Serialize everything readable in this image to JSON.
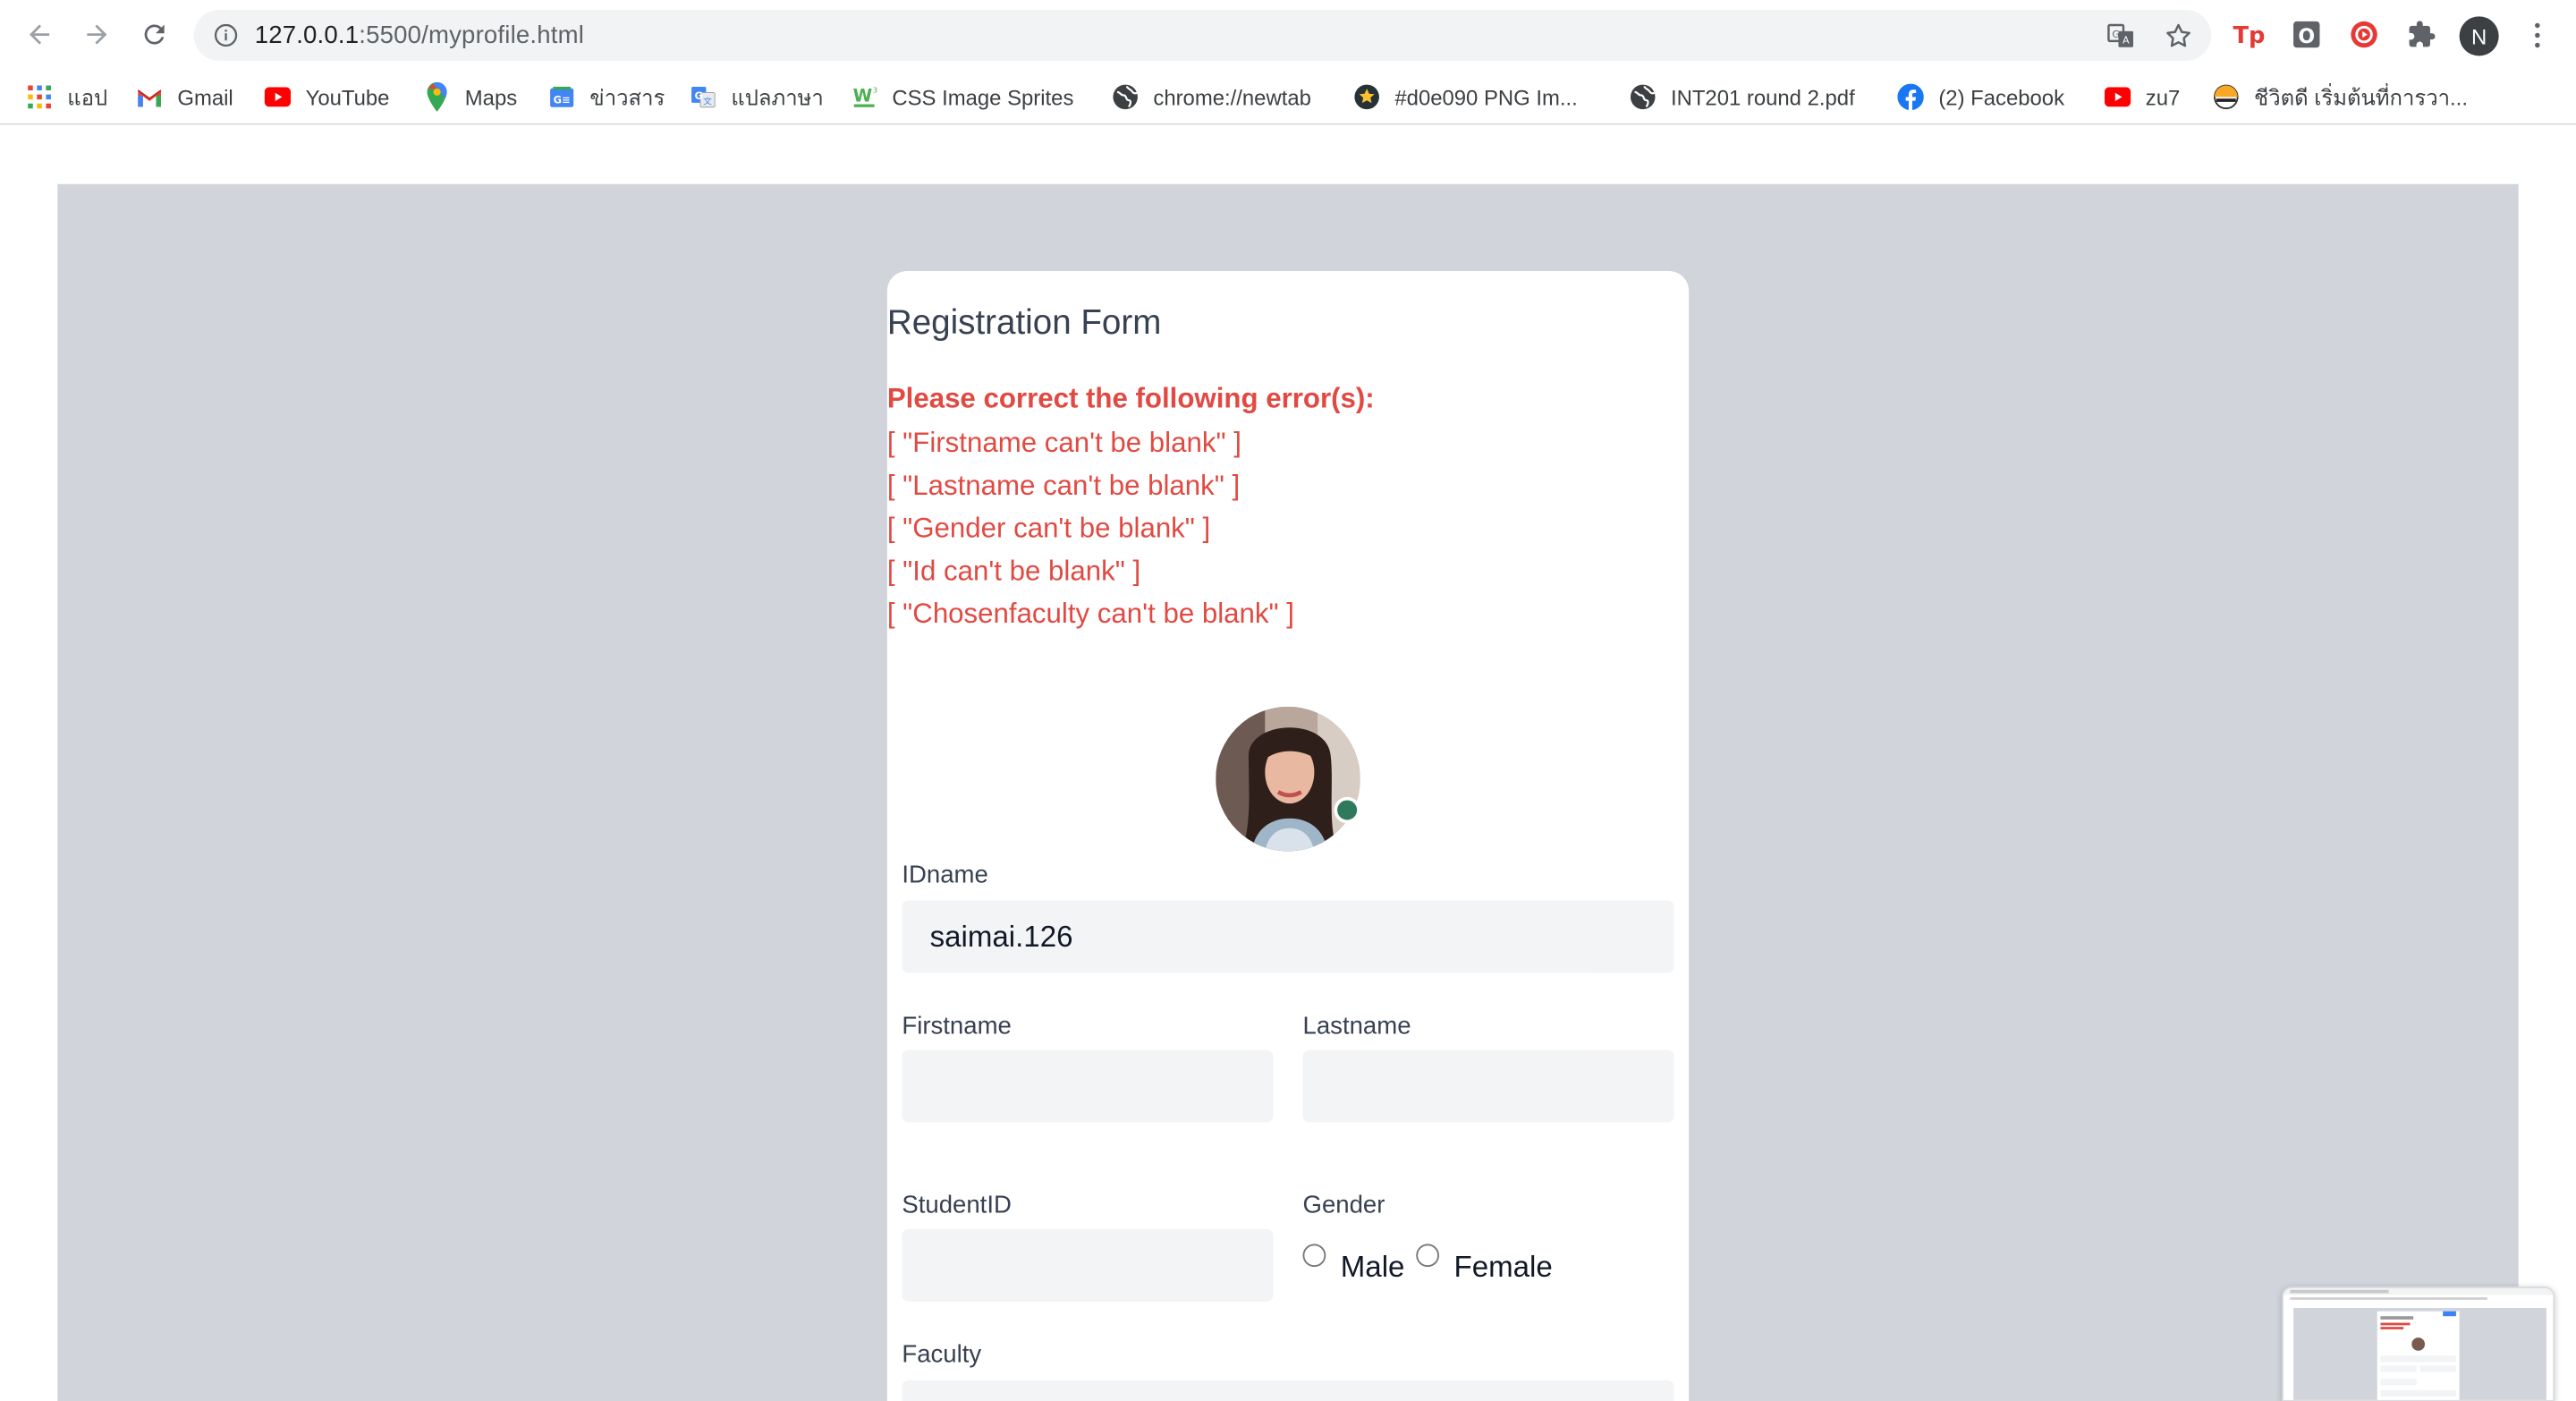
{
  "browser": {
    "url_host": "127.0.0.1",
    "url_path": ":5500/myprofile.html",
    "profile_initial": "N"
  },
  "bookmarks": [
    {
      "label": "แอป",
      "icon": "apps-grid-icon"
    },
    {
      "label": "Gmail",
      "icon": "gmail-icon"
    },
    {
      "label": "YouTube",
      "icon": "youtube-icon"
    },
    {
      "label": "Maps",
      "icon": "maps-pin-icon"
    },
    {
      "label": "ข่าวสาร",
      "icon": "google-news-icon"
    },
    {
      "label": "แปลภาษา",
      "icon": "google-translate-icon"
    },
    {
      "label": "CSS Image Sprites",
      "icon": "w3schools-icon"
    },
    {
      "label": "chrome://newtab",
      "icon": "globe-icon"
    },
    {
      "label": "#d0e090 PNG Im...",
      "icon": "star-badge-icon"
    },
    {
      "label": "INT201 round 2.pdf",
      "icon": "globe-icon"
    },
    {
      "label": "(2) Facebook",
      "icon": "facebook-icon"
    },
    {
      "label": "zu7",
      "icon": "youtube-icon"
    },
    {
      "label": "ชีวิตดี เริ่มต้นที่การวา...",
      "icon": "sun-logo-icon"
    }
  ],
  "form": {
    "title": "Registration Form",
    "error_heading": "Please correct the following error(s):",
    "errors": [
      "[ \"Firstname can't be blank\" ]",
      "[ \"Lastname can't be blank\" ]",
      "[ \"Gender can't be blank\" ]",
      "[ \"Id can't be blank\" ]",
      "[ \"Chosenfaculty can't be blank\" ]"
    ],
    "idname_label": "IDname",
    "idname_value": "saimai.126",
    "firstname_label": "Firstname",
    "firstname_value": "",
    "lastname_label": "Lastname",
    "lastname_value": "",
    "studentid_label": "StudentID",
    "studentid_value": "",
    "gender_label": "Gender",
    "gender_options": [
      "Male",
      "Female"
    ],
    "faculty_label": "Faculty"
  },
  "colors": {
    "error": "#e14a42",
    "page_bg": "#d1d5db",
    "input_bg": "#f3f4f6",
    "status_dot": "#2f7a5a"
  }
}
